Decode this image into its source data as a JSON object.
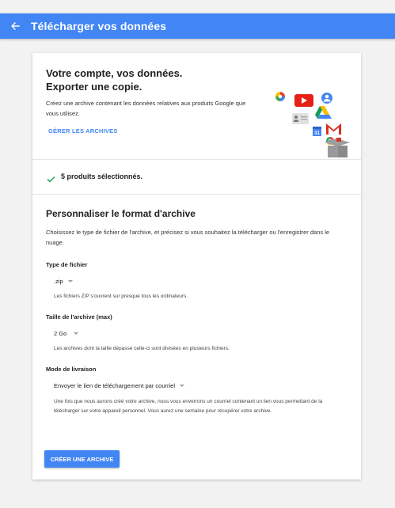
{
  "appbar": {
    "title": "Télécharger vos données",
    "back_icon": "arrow-left-icon"
  },
  "intro": {
    "headline_line1": "Votre compte, vos données.",
    "headline_line2": "Exporter une copie.",
    "description": "Créez une archive contenant les données relatives aux produits Google que vous utilisez.",
    "manage_link": "GÉRER LES ARCHIVES",
    "illustration_icons": [
      "photos-icon",
      "youtube-icon",
      "contacts-icon",
      "contact-card-icon",
      "drive-icon",
      "calendar-icon",
      "gmail-icon",
      "chrome-icon",
      "box-icon"
    ]
  },
  "selection": {
    "icon": "checkmark-icon",
    "text": "5 produits sélectionnés."
  },
  "customize": {
    "title": "Personnaliser le format d'archive",
    "description": "Choisissez le type de fichier de l'archive, et précisez si vous souhaitez la télécharger ou l'enregistrer dans le nuage.",
    "file_type": {
      "label": "Type de fichier",
      "value": ".zip",
      "note": "Les fichiers ZIP s'ouvrent sur presque tous les ordinateurs."
    },
    "archive_size": {
      "label": "Taille de l'archive (max)",
      "value": "2 Go",
      "note": "Les archives dont la taille dépasse celle-ci sont divisées en plusieurs fichiers."
    },
    "delivery": {
      "label": "Mode de livraison",
      "value": "Envoyer le lien de téléchargement par courriel",
      "note": "Une fois que nous aurons créé votre archive, nous vous enverrons un courriel contenant un lien vous permettant de la télécharger sur votre appareil personnel. Vous aurez une semaine pour récupérer votre archive."
    },
    "create_button": "CRÉER UNE ARCHIVE"
  },
  "colors": {
    "primary": "#4285f4",
    "check": "#0f9d58"
  }
}
